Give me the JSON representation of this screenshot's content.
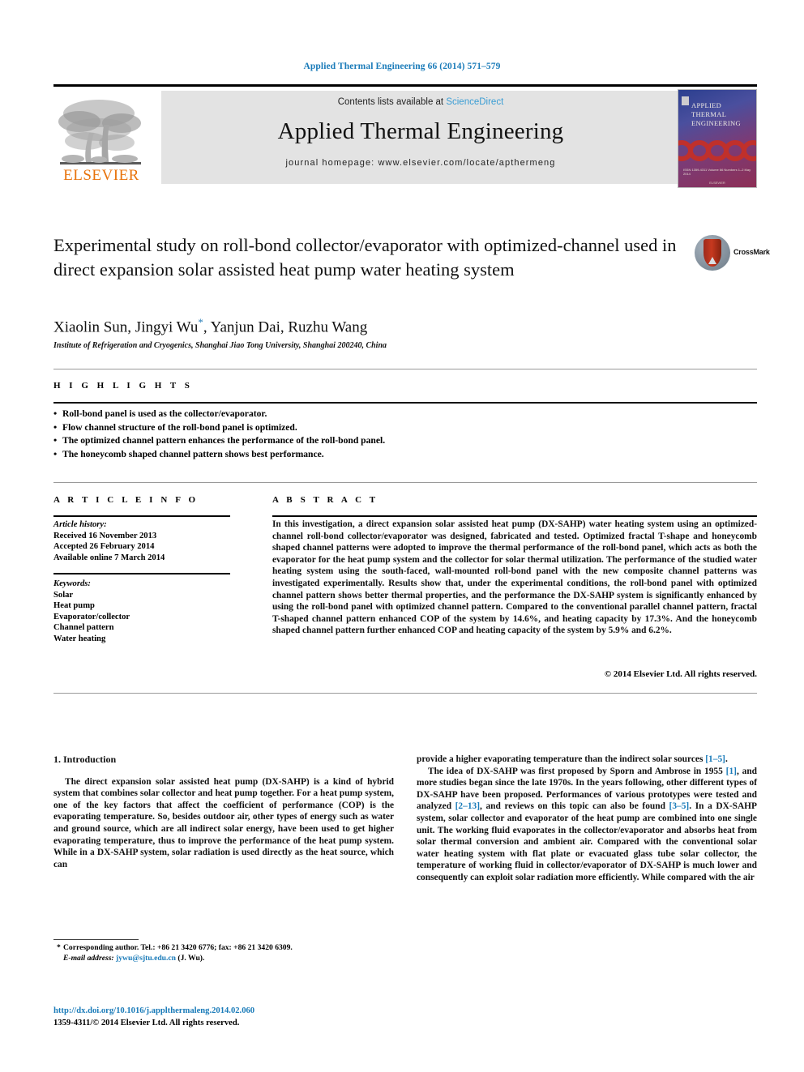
{
  "running_head": "Applied Thermal Engineering 66 (2014) 571–579",
  "masthead": {
    "publisher_wordmark": "ELSEVIER",
    "contents_prefix": "Contents lists available at ",
    "contents_link": "ScienceDirect",
    "journal_title": "Applied Thermal Engineering",
    "homepage": "journal homepage: www.elsevier.com/locate/apthermeng",
    "cover_title": "APPLIED THERMAL ENGINEERING",
    "cover_footer": "ISSN 1359-4311  Volume 66  Numbers 1–2  May 2014",
    "cover_publisher": "ELSEVIER",
    "link_color": "#3a9dd4",
    "brand_orange": "#e8730c"
  },
  "article": {
    "title": "Experimental study on roll-bond collector/evaporator with optimized-channel used in direct expansion solar assisted heat pump water heating system",
    "crossmark_label": "CrossMark",
    "authors": "Xiaolin Sun, Jingyi Wu",
    "authors_star": "*",
    "authors_tail": ", Yanjun Dai, Ruzhu Wang",
    "affiliation": "Institute of Refrigeration and Cryogenics, Shanghai Jiao Tong University, Shanghai 200240, China"
  },
  "highlights": {
    "heading": "H I G H L I G H T S",
    "items": [
      "Roll-bond panel is used as the collector/evaporator.",
      "Flow channel structure of the roll-bond panel is optimized.",
      "The optimized channel pattern enhances the performance of the roll-bond panel.",
      "The honeycomb shaped channel pattern shows best performance."
    ]
  },
  "article_info": {
    "heading": "A R T I C L E   I N F O",
    "history_label": "Article history:",
    "history": [
      "Received 16 November 2013",
      "Accepted 26 February 2014",
      "Available online 7 March 2014"
    ],
    "keywords_label": "Keywords:",
    "keywords": [
      "Solar",
      "Heat pump",
      "Evaporator/collector",
      "Channel pattern",
      "Water heating"
    ]
  },
  "abstract": {
    "heading": "A B S T R A C T",
    "text": "In this investigation, a direct expansion solar assisted heat pump (DX-SAHP) water heating system using an optimized-channel roll-bond collector/evaporator was designed, fabricated and tested. Optimized fractal T-shape and honeycomb shaped channel patterns were adopted to improve the thermal performance of the roll-bond panel, which acts as both the evaporator for the heat pump system and the collector for solar thermal utilization. The performance of the studied water heating system using the south-faced, wall-mounted roll-bond panel with the new composite channel patterns was investigated experimentally. Results show that, under the experimental conditions, the roll-bond panel with optimized channel pattern shows better thermal properties, and the performance the DX-SAHP system is significantly enhanced by using the roll-bond panel with optimized channel pattern. Compared to the conventional parallel channel pattern, fractal T-shaped channel pattern enhanced COP of the system by 14.6%, and heating capacity by 17.3%. And the honeycomb shaped channel pattern further enhanced COP and heating capacity of the system by 5.9% and 6.2%.",
    "copyright": "© 2014 Elsevier Ltd. All rights reserved."
  },
  "body": {
    "section_number_title": "1.  Introduction",
    "left_paragraph": "The direct expansion solar assisted heat pump (DX-SAHP) is a kind of hybrid system that combines solar collector and heat pump together. For a heat pump system, one of the key factors that affect the coefficient of performance (COP) is the evaporating temperature. So, besides outdoor air, other types of energy such as water and ground source, which are all indirect solar energy, have been used to get higher evaporating temperature, thus to improve the performance of the heat pump system. While in a DX-SAHP system, solar radiation is used directly as the heat source, which can",
    "right_paragraph_1_a": "provide a higher evaporating temperature than the indirect solar sources ",
    "right_paragraph_1_cite": "[1–5]",
    "right_paragraph_1_b": ".",
    "right_paragraph_2_a": "The idea of DX-SAHP was first proposed by Sporn and Ambrose in 1955 ",
    "right_paragraph_2_cite1": "[1]",
    "right_paragraph_2_b": ", and more studies began since the late 1970s. In the years following, other different types of DX-SAHP have been proposed. Performances of various prototypes were tested and analyzed ",
    "right_paragraph_2_cite2": "[2–13]",
    "right_paragraph_2_c": ", and reviews on this topic can also be found ",
    "right_paragraph_2_cite3": "[3–5]",
    "right_paragraph_2_d": ". In a DX-SAHP system, solar collector and evaporator of the heat pump are combined into one single unit. The working fluid evaporates in the collector/evaporator and absorbs heat from solar thermal conversion and ambient air. Compared with the conventional solar water heating system with flat plate or evacuated glass tube solar collector, the temperature of working fluid in collector/evaporator of DX-SAHP is much lower and consequently can exploit solar radiation more efficiently. While compared with the air"
  },
  "footer": {
    "corresponding_star": "*",
    "corresponding": "Corresponding author. Tel.: +86 21 3420 6776; fax: +86 21 3420 6309.",
    "email_label": "E-mail address:",
    "email": "jywu@sjtu.edu.cn",
    "email_owner": "(J. Wu).",
    "doi": "http://dx.doi.org/10.1016/j.applthermaleng.2014.02.060",
    "issn_line": "1359-4311/© 2014 Elsevier Ltd. All rights reserved."
  }
}
